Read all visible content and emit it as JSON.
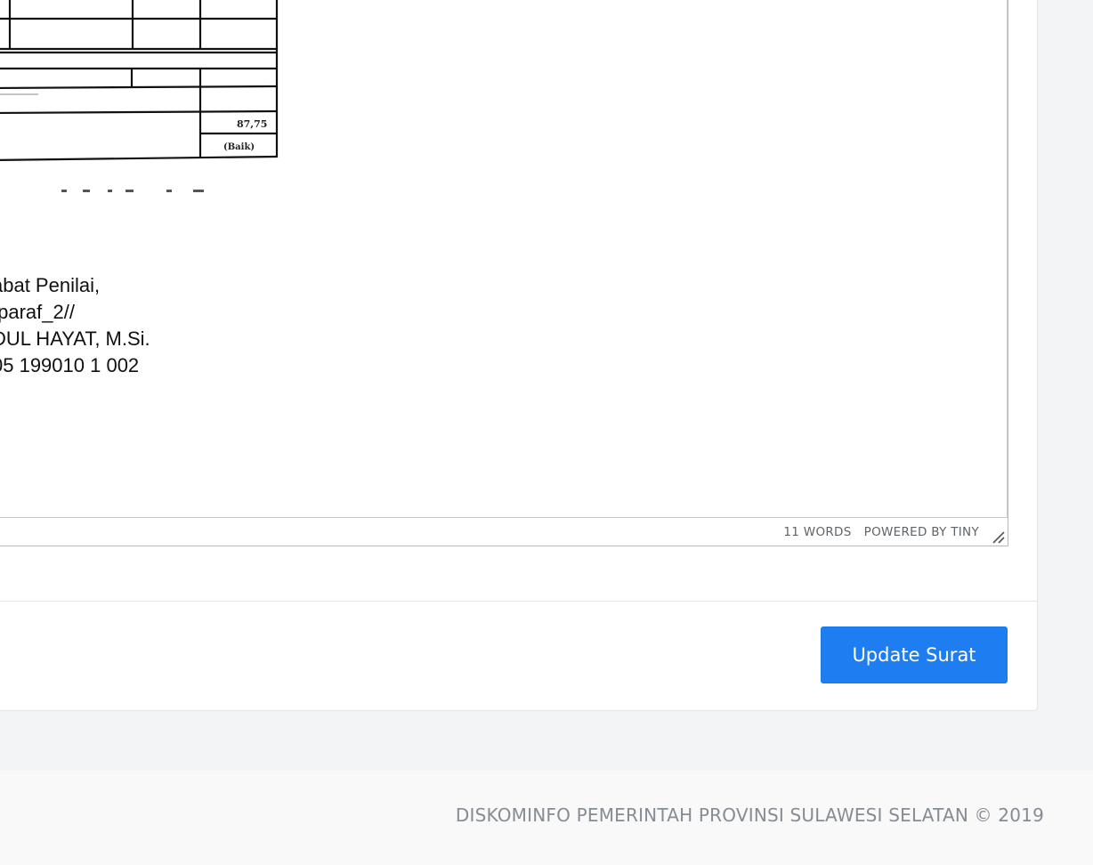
{
  "editor": {
    "document": {
      "table_score": "87,75",
      "table_predicate": "(Baik)",
      "signature_lines": [
        "abat Penilai,",
        "/paraf_2//",
        "DUL HAYAT, M.Si.",
        "05 199010 1 002"
      ]
    },
    "statusbar": {
      "word_count": "11 WORDS",
      "powered_by": "POWERED BY TINY"
    }
  },
  "form": {
    "submit_label": "Update Surat"
  },
  "footer": {
    "copyright": "DISKOMINFO PEMERINTAH PROVINSI SULAWESI SELATAN © 2019"
  },
  "colors": {
    "primary_button": "#1f7df2",
    "footer_text": "#858c93",
    "statusbar_text": "#5f6468"
  }
}
